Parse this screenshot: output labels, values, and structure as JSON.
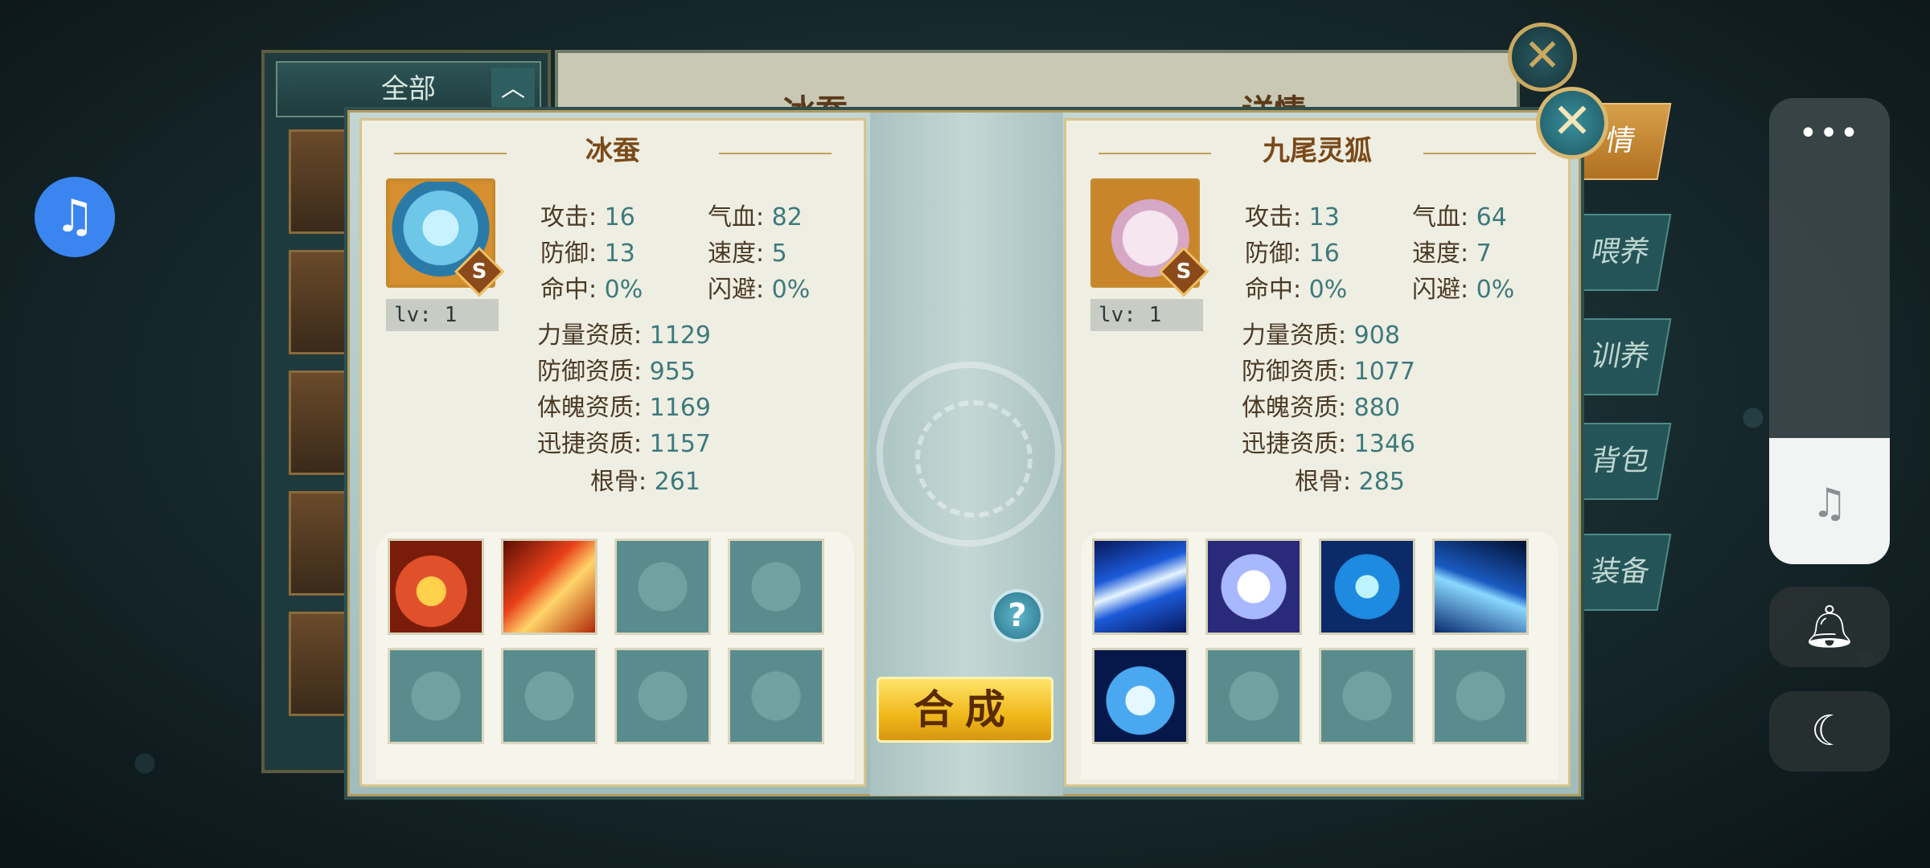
{
  "background": {
    "list_tab_all": "全部",
    "detail_title_left": "冰蚕",
    "detail_title_right": "详情",
    "side_tabs": [
      "情",
      "喂养",
      "训养",
      "背包",
      "装备"
    ]
  },
  "modal": {
    "help_label": "?",
    "merge_label": "合成",
    "left_pet": {
      "name": "冰蚕",
      "grade": "S",
      "level": "lv: 1",
      "stats": [
        {
          "label": "攻击:",
          "value": "16"
        },
        {
          "label": "气血:",
          "value": "82"
        },
        {
          "label": "防御:",
          "value": "13"
        },
        {
          "label": "速度:",
          "value": "5"
        },
        {
          "label": "命中:",
          "value": "0%"
        },
        {
          "label": "闪避:",
          "value": "0%"
        }
      ],
      "qualities": [
        {
          "label": "力量资质:",
          "value": "1129"
        },
        {
          "label": "防御资质:",
          "value": "955"
        },
        {
          "label": "体魄资质:",
          "value": "1169"
        },
        {
          "label": "迅捷资质:",
          "value": "1157"
        },
        {
          "label": "根骨:",
          "value": "261"
        }
      ],
      "skills": [
        "fire-orb-skill-icon",
        "fire-phoenix-skill-icon",
        "empty",
        "empty",
        "empty",
        "empty",
        "empty",
        "empty"
      ]
    },
    "right_pet": {
      "name": "九尾灵狐",
      "grade": "S",
      "level": "lv: 1",
      "stats": [
        {
          "label": "攻击:",
          "value": "13"
        },
        {
          "label": "气血:",
          "value": "64"
        },
        {
          "label": "防御:",
          "value": "16"
        },
        {
          "label": "速度:",
          "value": "7"
        },
        {
          "label": "命中:",
          "value": "0%"
        },
        {
          "label": "闪避:",
          "value": "0%"
        }
      ],
      "qualities": [
        {
          "label": "力量资质:",
          "value": "908"
        },
        {
          "label": "防御资质:",
          "value": "1077"
        },
        {
          "label": "体魄资质:",
          "value": "880"
        },
        {
          "label": "迅捷资质:",
          "value": "1346"
        },
        {
          "label": "根骨:",
          "value": "285"
        }
      ],
      "skills": [
        "light-beam-skill-icon",
        "spirit-orb-skill-icon",
        "crossed-blades-skill-icon",
        "ice-spike-skill-icon",
        "water-heart-skill-icon",
        "empty",
        "empty",
        "empty"
      ]
    }
  },
  "overlay": {
    "more_label": "•••",
    "volume_level": 0.27
  },
  "colors": {
    "accent_gold": "#f0b81a",
    "value_teal": "#3d7a7c",
    "music_blue": "#3a85f0"
  }
}
